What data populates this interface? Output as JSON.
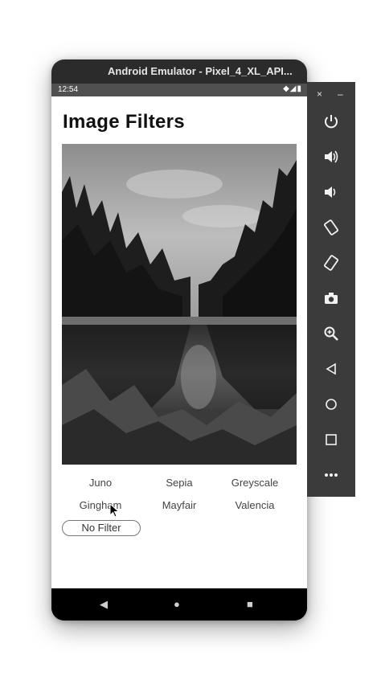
{
  "emulator": {
    "title": "Android Emulator - Pixel_4_XL_API...",
    "close_glyph": "×",
    "minimize_glyph": "–"
  },
  "statusbar": {
    "time": "12:54",
    "icons": "◆◢▮"
  },
  "app": {
    "title": "Image Filters"
  },
  "filters": {
    "items": [
      "Juno",
      "Sepia",
      "Greyscale",
      "Gingham",
      "Mayfair",
      "Valencia"
    ],
    "no_filter_label": "No Filter"
  },
  "sidepanel": {
    "buttons": [
      "power-icon",
      "volume-up-icon",
      "volume-down-icon",
      "rotate-left-icon",
      "rotate-right-icon",
      "camera-icon",
      "zoom-icon",
      "back-icon",
      "home-icon",
      "overview-icon",
      "more-icon"
    ]
  },
  "navbar": {
    "back": "◀",
    "home": "●",
    "recents": "■"
  }
}
